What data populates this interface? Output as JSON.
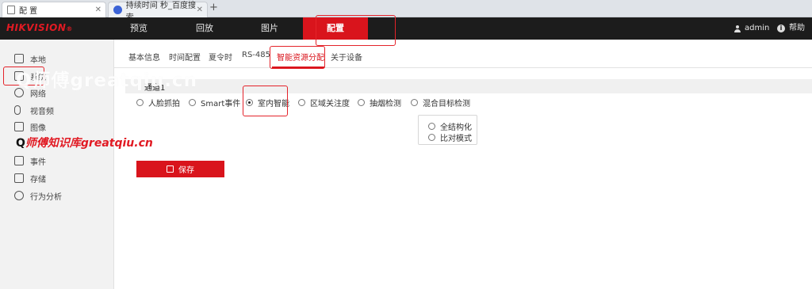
{
  "browser": {
    "tabs": [
      {
        "title": "配 置",
        "active": true
      },
      {
        "title": "持续时间 秒_百度搜索",
        "active": false
      }
    ],
    "new_tab_symbol": "+"
  },
  "topnav": {
    "logo": "HIKVISION",
    "logo_suffix": "®",
    "items": [
      "预览",
      "回放",
      "图片",
      "配置"
    ],
    "active_item": "配置",
    "user": "admin",
    "help": "帮助"
  },
  "sidebar": {
    "items": [
      {
        "label": "本地",
        "icon": "monitor-icon"
      },
      {
        "label": "系统",
        "icon": "system-icon"
      },
      {
        "label": "网络",
        "icon": "globe-icon"
      },
      {
        "label": "视音频",
        "icon": "mic-icon"
      },
      {
        "label": "图像",
        "icon": "image-icon"
      },
      {
        "label": "",
        "icon": "event-icon"
      },
      {
        "label": "事件",
        "icon": "calendar-icon"
      },
      {
        "label": "存储",
        "icon": "storage-icon"
      },
      {
        "label": "行为分析",
        "icon": "behavior-icon"
      }
    ]
  },
  "subtabs": {
    "items": [
      "基本信息",
      "时间配置",
      "夏令时",
      "RS-485",
      "智能资源分配",
      "关于设备"
    ],
    "active": "智能资源分配"
  },
  "section": {
    "title": "通道1"
  },
  "options": {
    "items": [
      "人脸抓拍",
      "Smart事件",
      "室内智能",
      "区域关注度",
      "抽烟检测",
      "混合目标检测"
    ],
    "selected": "室内智能"
  },
  "popup": {
    "items": [
      "全结构化",
      "比对模式"
    ]
  },
  "save_button": {
    "label": "保存"
  },
  "watermarks": {
    "large": "Q师傅greatqiu.cn",
    "small_prefix": "Q",
    "small": "师傅知识库greatqiu.cn"
  },
  "colors": {
    "accent": "#d9141c",
    "topnav_bg": "#1c1c1c",
    "sidebar_bg": "#f2f2f2"
  }
}
